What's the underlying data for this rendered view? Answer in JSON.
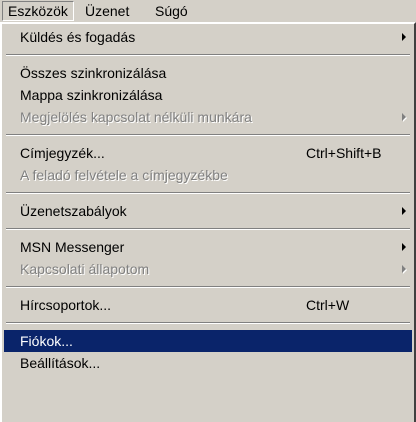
{
  "menubar": {
    "items": [
      {
        "label": "Eszközök"
      },
      {
        "label": "Üzenet"
      },
      {
        "label": "Súgó"
      }
    ]
  },
  "menu": {
    "items": [
      {
        "label": "Küldés és fogadás"
      },
      {
        "label": "Összes szinkronizálása"
      },
      {
        "label": "Mappa szinkronizálása"
      },
      {
        "label": "Megjelölés kapcsolat nélküli munkára"
      },
      {
        "label": "Címjegyzék...",
        "shortcut": "Ctrl+Shift+B"
      },
      {
        "label": "A feladó felvétele a címjegyzékbe"
      },
      {
        "label": "Üzenetszabályok"
      },
      {
        "label": "MSN Messenger"
      },
      {
        "label": "Kapcsolati állapotom"
      },
      {
        "label": "Hírcsoportok...",
        "shortcut": "Ctrl+W"
      },
      {
        "label": "Fiókok..."
      },
      {
        "label": "Beállítások..."
      }
    ]
  },
  "colors": {
    "face": "#d4d0c8",
    "highlight": "#0a246a",
    "disabled_text": "#808080"
  }
}
